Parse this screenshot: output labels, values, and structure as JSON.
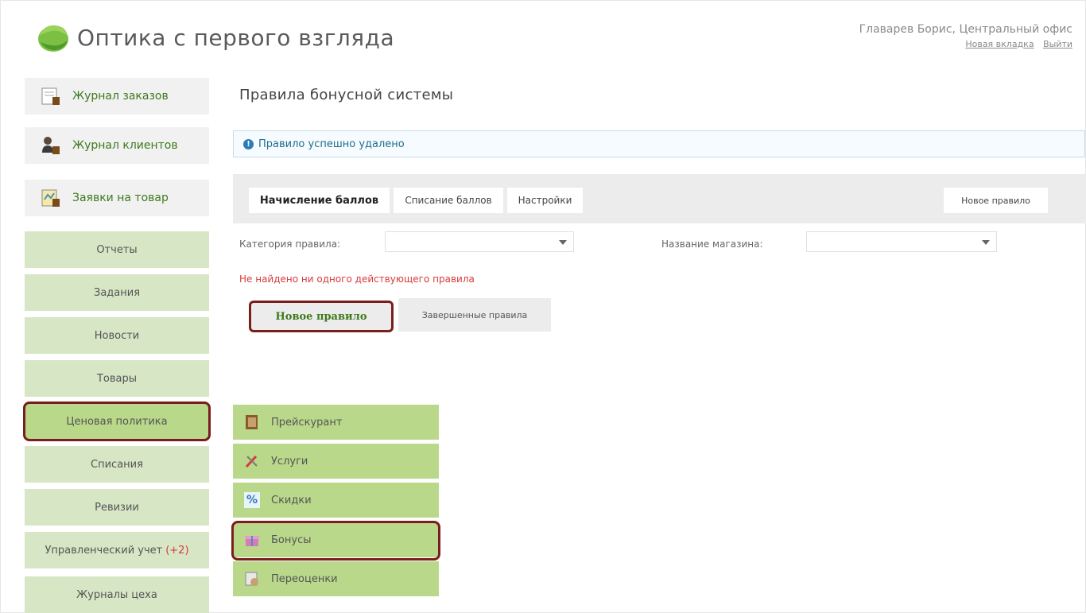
{
  "header": {
    "app_title": "Оптика с первого взгляда",
    "user_name": "Главарев Борис, Центральный офис",
    "link_new_tab": "Новая вкладка",
    "link_logout": "Выйти"
  },
  "sidebar": {
    "items": [
      {
        "label": "Журнал заказов",
        "icon": "journal-icon"
      },
      {
        "label": "Журнал клиентов",
        "icon": "clients-icon"
      },
      {
        "label": "Заявки на товар",
        "icon": "requests-icon"
      },
      {
        "label": "Отчеты"
      },
      {
        "label": "Задания"
      },
      {
        "label": "Новости"
      },
      {
        "label": "Товары"
      },
      {
        "label": "Ценовая политика",
        "highlighted": true
      },
      {
        "label": "Списания"
      },
      {
        "label": "Ревизии"
      },
      {
        "label": "Управленческий учет",
        "badge": "(+2)"
      },
      {
        "label": "Журналы цеха"
      }
    ]
  },
  "submenu": {
    "items": [
      {
        "label": "Прейскурант",
        "icon": "price-list-icon"
      },
      {
        "label": "Услуги",
        "icon": "services-icon"
      },
      {
        "label": "Скидки",
        "icon": "discount-icon"
      },
      {
        "label": "Бонусы",
        "icon": "gift-icon",
        "highlighted": true
      },
      {
        "label": "Переоценки",
        "icon": "revaluation-icon"
      }
    ]
  },
  "main": {
    "page_title": "Правила бонусной системы",
    "notice": "Правило успешно удалено",
    "tabs": [
      {
        "label": "Начисление баллов",
        "active": true
      },
      {
        "label": "Списание баллов"
      },
      {
        "label": "Настройки"
      }
    ],
    "new_rule_tab": "Новое правило",
    "filters": {
      "category_label": "Категория правила:",
      "category_value": "",
      "shop_label": "Название магазина:",
      "shop_value": ""
    },
    "empty_message": "Не найдено ни одного действующего правила",
    "buttons": {
      "new_rule": "Новое правило",
      "finished_rules": "Завершенные правила"
    }
  },
  "colors": {
    "accent_green": "#b9d88a",
    "light_green": "#d7e6c5",
    "highlight_border": "#7a1d1d",
    "error_red": "#d83b3b",
    "link_green": "#3d7a1d"
  }
}
